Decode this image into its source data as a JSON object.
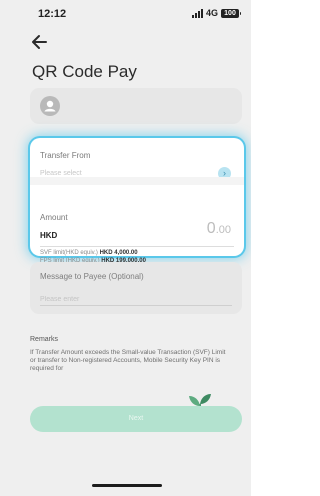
{
  "status_bar": {
    "time": "12:12",
    "network": "4G",
    "battery": "100"
  },
  "header": {
    "title": "QR Code Pay"
  },
  "transfer_from": {
    "label": "Transfer From",
    "placeholder": "Please select"
  },
  "amount": {
    "label": "Amount",
    "currency": "HKD",
    "value_main": "0",
    "value_decimal": ".00",
    "svf_limit_label": "SVF limit(HKD equiv.)",
    "svf_limit_value": "HKD 4,000.00",
    "fps_limit_label": "FPS limit (HKD equiv.)",
    "fps_limit_value": "HKD 199,000.00"
  },
  "message": {
    "label": "Message to Payee (Optional)",
    "placeholder": "Please enter"
  },
  "remarks": {
    "title": "Remarks",
    "text": "If Transfer Amount exceeds the Small-value Transaction (SVF) Limit or transfer to Non-registered Accounts, Mobile Security Key PIN is required for"
  },
  "footer": {
    "next_label": "Next"
  },
  "colors": {
    "accent_glow": "#5ac8ea",
    "next_button": "#b3e2cf",
    "background": "#efefef"
  },
  "icons": {
    "back": "back-arrow-icon",
    "chevron": "chevron-right-icon",
    "avatar": "user-avatar-icon",
    "plant": "plant-sprout-icon"
  }
}
